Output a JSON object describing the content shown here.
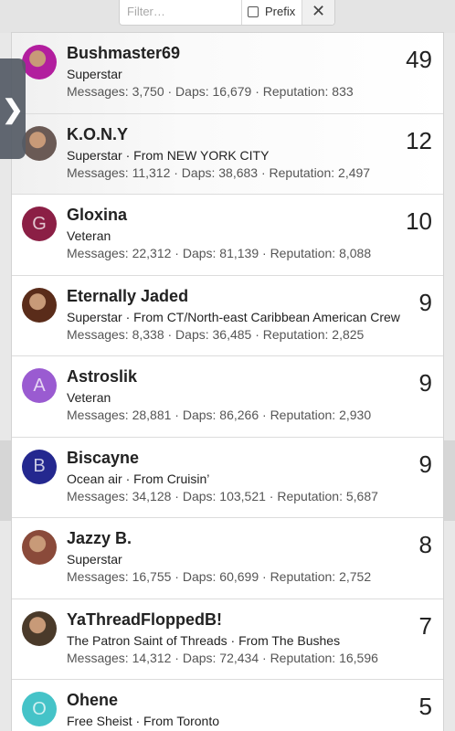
{
  "filter": {
    "placeholder": "Filter…",
    "prefix_label": "Prefix",
    "close_glyph": "✕"
  },
  "side_tab": {
    "glyph": "❯"
  },
  "users": [
    {
      "name": "Bushmaster69",
      "title": "Superstar",
      "stats": "Messages: 3,750 · Daps: 16,679 · Reputation: 833",
      "count": "49",
      "avatar_letter": "",
      "avatar_color": "#b21e9e",
      "avatar_kind": "photo"
    },
    {
      "name": "K.O.N.Y",
      "title": "Superstar · From NEW YORK CITY",
      "stats": "Messages: 11,312 · Daps: 38,683 · Reputation: 2,497",
      "count": "12",
      "avatar_letter": "",
      "avatar_color": "#6a5a55",
      "avatar_kind": "photo"
    },
    {
      "name": "Gloxina",
      "title": "Veteran",
      "stats": "Messages: 22,312 · Daps: 81,139 · Reputation: 8,088",
      "count": "10",
      "avatar_letter": "G",
      "avatar_color": "#8b1f45",
      "avatar_kind": "letter"
    },
    {
      "name": "Eternally Jaded",
      "title": "Superstar · From CT/North-east Caribbean American Crew",
      "stats": "Messages: 8,338 · Daps: 36,485 · Reputation: 2,825",
      "count": "9",
      "avatar_letter": "",
      "avatar_color": "#5a2c1a",
      "avatar_kind": "photo"
    },
    {
      "name": "Astroslik",
      "title": "Veteran",
      "stats": "Messages: 28,881 · Daps: 86,266 · Reputation: 2,930",
      "count": "9",
      "avatar_letter": "A",
      "avatar_color": "#9a5bd1",
      "avatar_kind": "letter"
    },
    {
      "name": "Biscayne",
      "title": "Ocean air · From Cruisin’",
      "stats": "Messages: 34,128 · Daps: 103,521 · Reputation: 5,687",
      "count": "9",
      "avatar_letter": "B",
      "avatar_color": "#24288f",
      "avatar_kind": "letter"
    },
    {
      "name": "Jazzy B.",
      "title": "Superstar",
      "stats": "Messages: 16,755 · Daps: 60,699 · Reputation: 2,752",
      "count": "8",
      "avatar_letter": "",
      "avatar_color": "#8a4a3a",
      "avatar_kind": "photo"
    },
    {
      "name": "YaThreadFloppedB!",
      "title": "The Patron Saint of Threads · From The Bushes",
      "stats": "Messages: 14,312 · Daps: 72,434 · Reputation: 16,596",
      "count": "7",
      "avatar_letter": "",
      "avatar_color": "#4a3a2a",
      "avatar_kind": "photo"
    },
    {
      "name": "Ohene",
      "title": "Free Sheist · From Toronto",
      "stats": "",
      "count": "5",
      "avatar_letter": "O",
      "avatar_color": "#45c3c8",
      "avatar_kind": "letter"
    }
  ]
}
